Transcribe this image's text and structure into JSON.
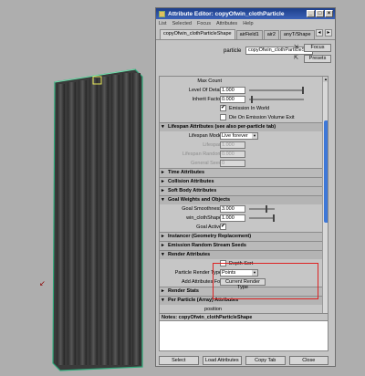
{
  "window": {
    "title": "Attribute Editor: copyOfwin_clothParticle"
  },
  "menu": [
    "List",
    "Selected",
    "Focus",
    "Attributes",
    "Help"
  ],
  "tabs": [
    "copyOfwin_clothParticleShape",
    "airField1",
    "air2",
    "anyT/Shape"
  ],
  "node": {
    "label": "particle",
    "value": "copyOfwin_clothParticleShape",
    "focus": "Focus",
    "presets": "Presets"
  },
  "rows_top": {
    "max_count": "Max Count",
    "lod_label": "Level Of Detail",
    "lod_value": "1.000",
    "inherit_label": "Inherit Factor",
    "inherit_value": "0.000",
    "emission_world": "Emission In World",
    "die_emission": "Die On Emission Volume Exit"
  },
  "sections": {
    "lifespan": "Lifespan Attributes (see also per-particle tab)",
    "time": "Time Attributes",
    "collision": "Collision Attributes",
    "soft_body": "Soft Body Attributes",
    "goal": "Goal Weights and Objects",
    "instancer": "Instancer (Geometry Replacement)",
    "emission_random": "Emission Random Stream Seeds",
    "render": "Render Attributes",
    "render_stats": "Render Stats",
    "per_particle": "Per Particle (Array) Attributes"
  },
  "lifespan": {
    "mode_label": "Lifespan Mode",
    "mode_value": "Live forever",
    "lifespan_label": "Lifespan",
    "lifespan_value": "1.000",
    "random_label": "Lifespan Random",
    "random_value": "0.000",
    "seed_label": "General Seed",
    "seed_value": "0"
  },
  "goal": {
    "smooth_label": "Goal Smoothness",
    "smooth_value": "3.000",
    "shape_label": "win_clothShape",
    "shape_value": "1.000",
    "active_label": "Goal Active",
    "active_check": "✔"
  },
  "render": {
    "depth_sort": "Depth Sort",
    "type_label": "Particle Render Type",
    "type_value": "Points",
    "add_label": "Add Attributes For",
    "add_button": "Current Render Type"
  },
  "per_particle": {
    "position_label": "position"
  },
  "notes": {
    "header": "Notes: copyOfwin_clothParticleShape"
  },
  "buttons": {
    "select": "Select",
    "load": "Load Attributes",
    "copy_tab": "Copy Tab",
    "close": "Close"
  },
  "colors": {
    "title_bar": "#1d3f8a",
    "scroll_thumb": "#3e78d8",
    "highlight_box": "#d22222",
    "cloth": "#3a3a3a",
    "wireframe": "#2faa7a"
  }
}
